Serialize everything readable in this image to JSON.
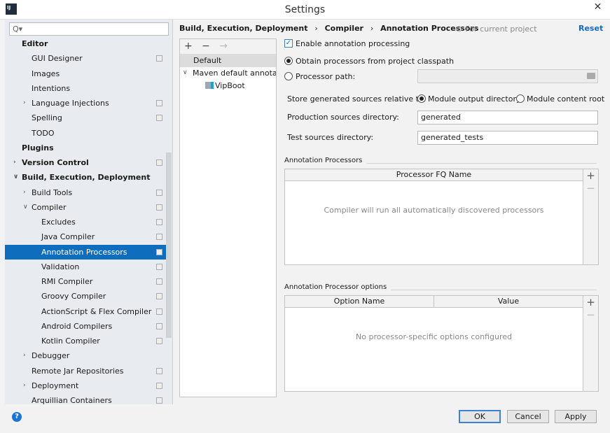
{
  "window": {
    "title": "Settings",
    "logo": "IJ",
    "close_icon": "close-icon"
  },
  "sidebar": {
    "search_placeholder": "Q▾",
    "items": [
      {
        "label": "Editor",
        "level": 0,
        "bold": true
      },
      {
        "label": "GUI Designer",
        "level": 1,
        "copy": true
      },
      {
        "label": "Images",
        "level": 1
      },
      {
        "label": "Intentions",
        "level": 1
      },
      {
        "label": "Language Injections",
        "level": 1,
        "arrow": "›",
        "copy": true
      },
      {
        "label": "Spelling",
        "level": 1,
        "copy": true
      },
      {
        "label": "TODO",
        "level": 1
      },
      {
        "label": "Plugins",
        "level": 0,
        "bold": true
      },
      {
        "label": "Version Control",
        "level": 0,
        "bold": true,
        "arrow": "›",
        "copy": true
      },
      {
        "label": "Build, Execution, Deployment",
        "level": 0,
        "bold": true,
        "arrow": "∨"
      },
      {
        "label": "Build Tools",
        "level": 1,
        "arrow": "›",
        "copy": true
      },
      {
        "label": "Compiler",
        "level": 1,
        "arrow": "∨",
        "copy": true
      },
      {
        "label": "Excludes",
        "level": 2,
        "copy": true
      },
      {
        "label": "Java Compiler",
        "level": 2,
        "copy": true
      },
      {
        "label": "Annotation Processors",
        "level": 2,
        "copy": true,
        "selected": true
      },
      {
        "label": "Validation",
        "level": 2,
        "copy": true
      },
      {
        "label": "RMI Compiler",
        "level": 2,
        "copy": true
      },
      {
        "label": "Groovy Compiler",
        "level": 2,
        "copy": true
      },
      {
        "label": "ActionScript & Flex Compiler",
        "level": 2,
        "copy": true
      },
      {
        "label": "Android Compilers",
        "level": 2,
        "copy": true
      },
      {
        "label": "Kotlin Compiler",
        "level": 2,
        "copy": true
      },
      {
        "label": "Debugger",
        "level": 1,
        "arrow": "›"
      },
      {
        "label": "Remote Jar Repositories",
        "level": 1,
        "copy": true
      },
      {
        "label": "Deployment",
        "level": 1,
        "arrow": "›",
        "copy": true
      },
      {
        "label": "Arquillian Containers",
        "level": 1,
        "copy": true
      }
    ]
  },
  "breadcrumb": {
    "part1": "Build, Execution, Deployment",
    "part2": "Compiler",
    "part3": "Annotation Processors",
    "sep": "›"
  },
  "scope": "© For current project",
  "reset": "Reset",
  "profiles": {
    "toolbar": {
      "add": "+",
      "remove": "−",
      "move": "→"
    },
    "items": [
      {
        "label": "Default",
        "selected": true
      },
      {
        "label": "Maven default annotatic",
        "arrow": "∨"
      },
      {
        "label": "VipBoot",
        "module": true
      }
    ]
  },
  "form": {
    "enable": "Enable annotation processing",
    "enable_checked": true,
    "obtain": "Obtain processors from project classpath",
    "obtain_selected": true,
    "processor_path": "Processor path:",
    "processor_path_value": "",
    "store_label": "Store generated sources relative to:",
    "module_output": "Module output directory",
    "module_output_selected": true,
    "module_content": "Module content root",
    "prod_label": "Production sources directory:",
    "prod_value": "generated",
    "test_label": "Test sources directory:",
    "test_value": "generated_tests"
  },
  "processors": {
    "title": "Annotation Processors",
    "column": "Processor FQ Name",
    "empty": "Compiler will run all automatically discovered processors"
  },
  "options": {
    "title": "Annotation Processor options",
    "columns": [
      "Option Name",
      "Value"
    ],
    "empty": "No processor-specific options configured"
  },
  "side_buttons": {
    "add": "+",
    "remove": "−"
  },
  "buttons": {
    "help": "?",
    "ok": "OK",
    "cancel": "Cancel",
    "apply": "Apply"
  }
}
